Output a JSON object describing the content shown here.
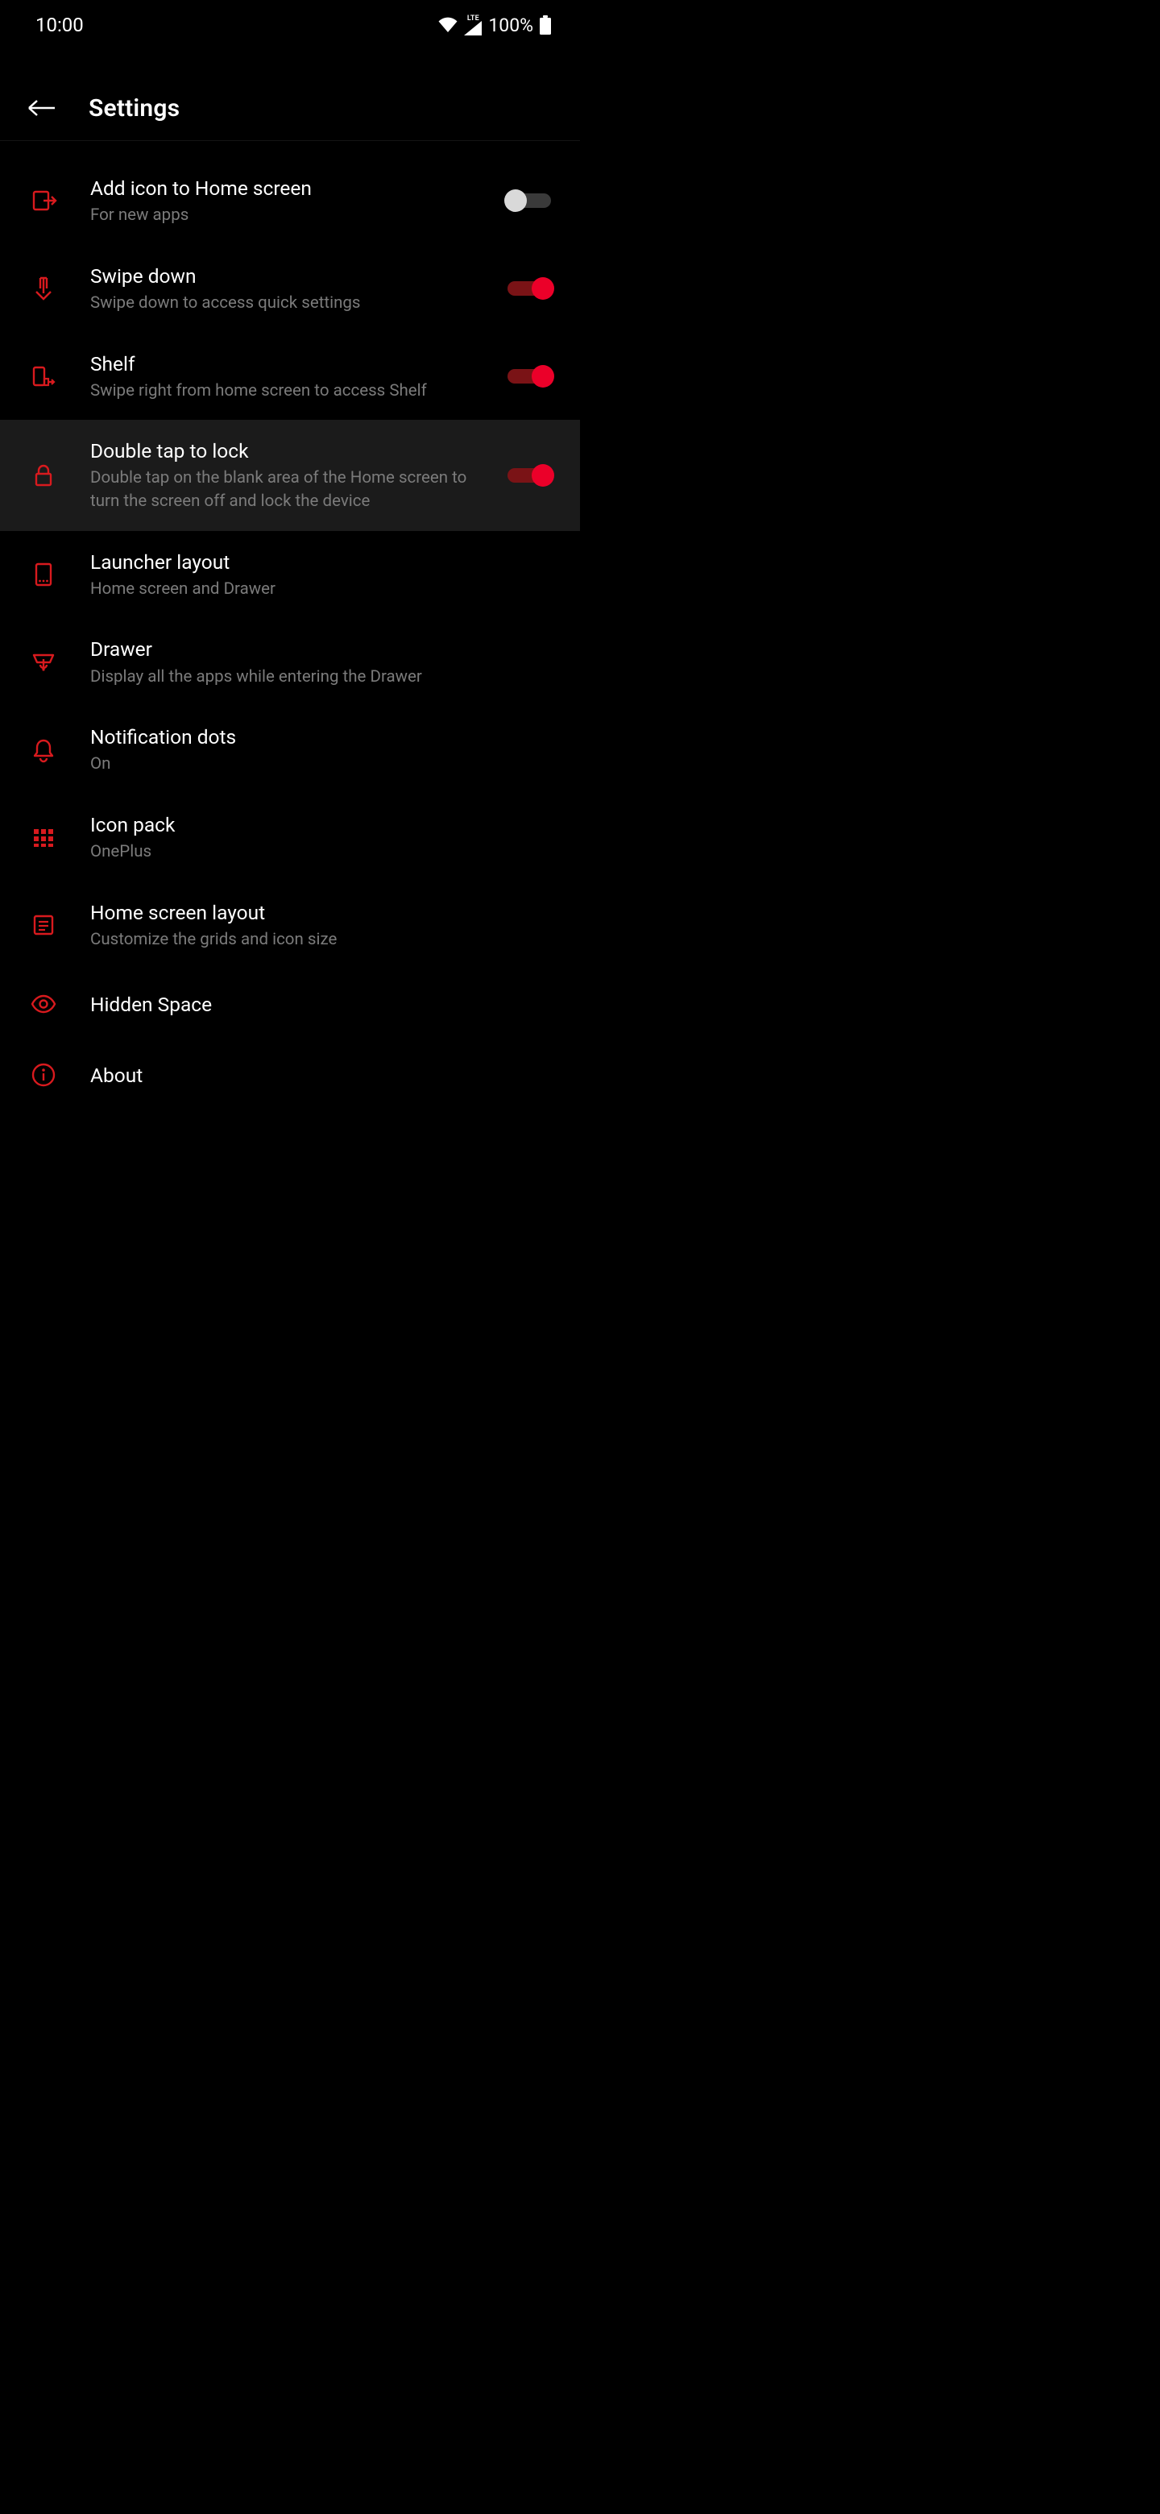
{
  "status": {
    "time": "10:00",
    "battery": "100%",
    "network_type": "LTE"
  },
  "header": {
    "title": "Settings"
  },
  "rows": {
    "add_icon": {
      "title": "Add icon to Home screen",
      "sub": "For new apps"
    },
    "swipe_down": {
      "title": "Swipe down",
      "sub": "Swipe down to access quick settings"
    },
    "shelf": {
      "title": "Shelf",
      "sub": "Swipe right from home screen to access Shelf"
    },
    "double_tap": {
      "title": "Double tap to lock",
      "sub": "Double tap on the blank area of the Home screen to turn the screen off and lock the device"
    },
    "launcher_layout": {
      "title": "Launcher layout",
      "sub": "Home screen and Drawer"
    },
    "drawer": {
      "title": "Drawer",
      "sub": "Display all the apps while entering the Drawer"
    },
    "notification_dots": {
      "title": "Notification dots",
      "sub": "On"
    },
    "icon_pack": {
      "title": "Icon pack",
      "sub": "OnePlus"
    },
    "home_layout": {
      "title": "Home screen layout",
      "sub": "Customize the grids and icon size"
    },
    "hidden_space": {
      "title": "Hidden Space"
    },
    "about": {
      "title": "About"
    }
  },
  "toggles": {
    "add_icon": false,
    "swipe_down": true,
    "shelf": true,
    "double_tap": true
  },
  "colors": {
    "accent": "#eb0029",
    "icon": "#d81a1e"
  }
}
